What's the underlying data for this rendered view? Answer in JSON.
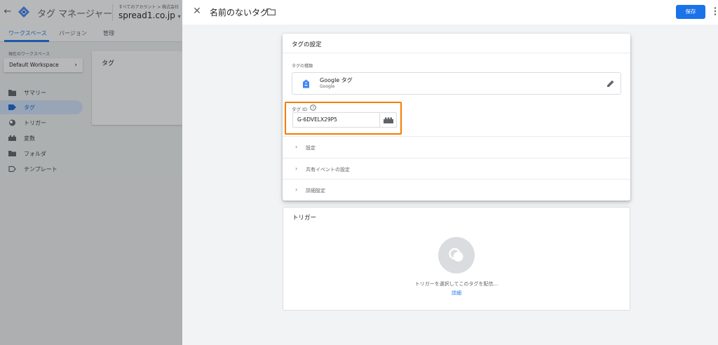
{
  "app": {
    "title": "タグ マネージャー",
    "account_path": "すべてのアカウント > 株式会社",
    "account_name": "spread1.co.jp",
    "account_dropdown": "▾",
    "tabs": [
      {
        "label": "ワークスペース",
        "active": true
      },
      {
        "label": "バージョン",
        "active": false
      },
      {
        "label": "管理",
        "active": false
      }
    ],
    "workspace_label": "現在のワークスペース",
    "workspace_name": "Default Workspace",
    "nav": [
      {
        "label": "サマリー",
        "icon": "summary-icon",
        "active": false
      },
      {
        "label": "タグ",
        "icon": "tag-icon",
        "active": true
      },
      {
        "label": "トリガー",
        "icon": "trigger-icon",
        "active": false
      },
      {
        "label": "変数",
        "icon": "variable-icon",
        "active": false
      },
      {
        "label": "フォルダ",
        "icon": "folder-icon",
        "active": false
      },
      {
        "label": "テンプレート",
        "icon": "template-icon",
        "active": false
      }
    ],
    "content_card_title": "タグ"
  },
  "editor": {
    "tag_name": "名前のないタグ",
    "save_label": "保存",
    "config": {
      "title": "タグの設定",
      "type_label": "タグの種類",
      "type_name": "Google タグ",
      "type_vendor": "Google",
      "tag_id_label": "タグ ID",
      "tag_id_value": "G-6DVELX29P5",
      "sections": [
        "設定",
        "共有イベントの設定",
        "詳細設定"
      ]
    },
    "trigger": {
      "title": "トリガー",
      "hint": "トリガーを選択してこのタグを配信...",
      "link": "詳細"
    }
  },
  "colors": {
    "accent": "#1a73e8",
    "highlight": "#f57c00",
    "nav_active": "#d2e3fc"
  }
}
